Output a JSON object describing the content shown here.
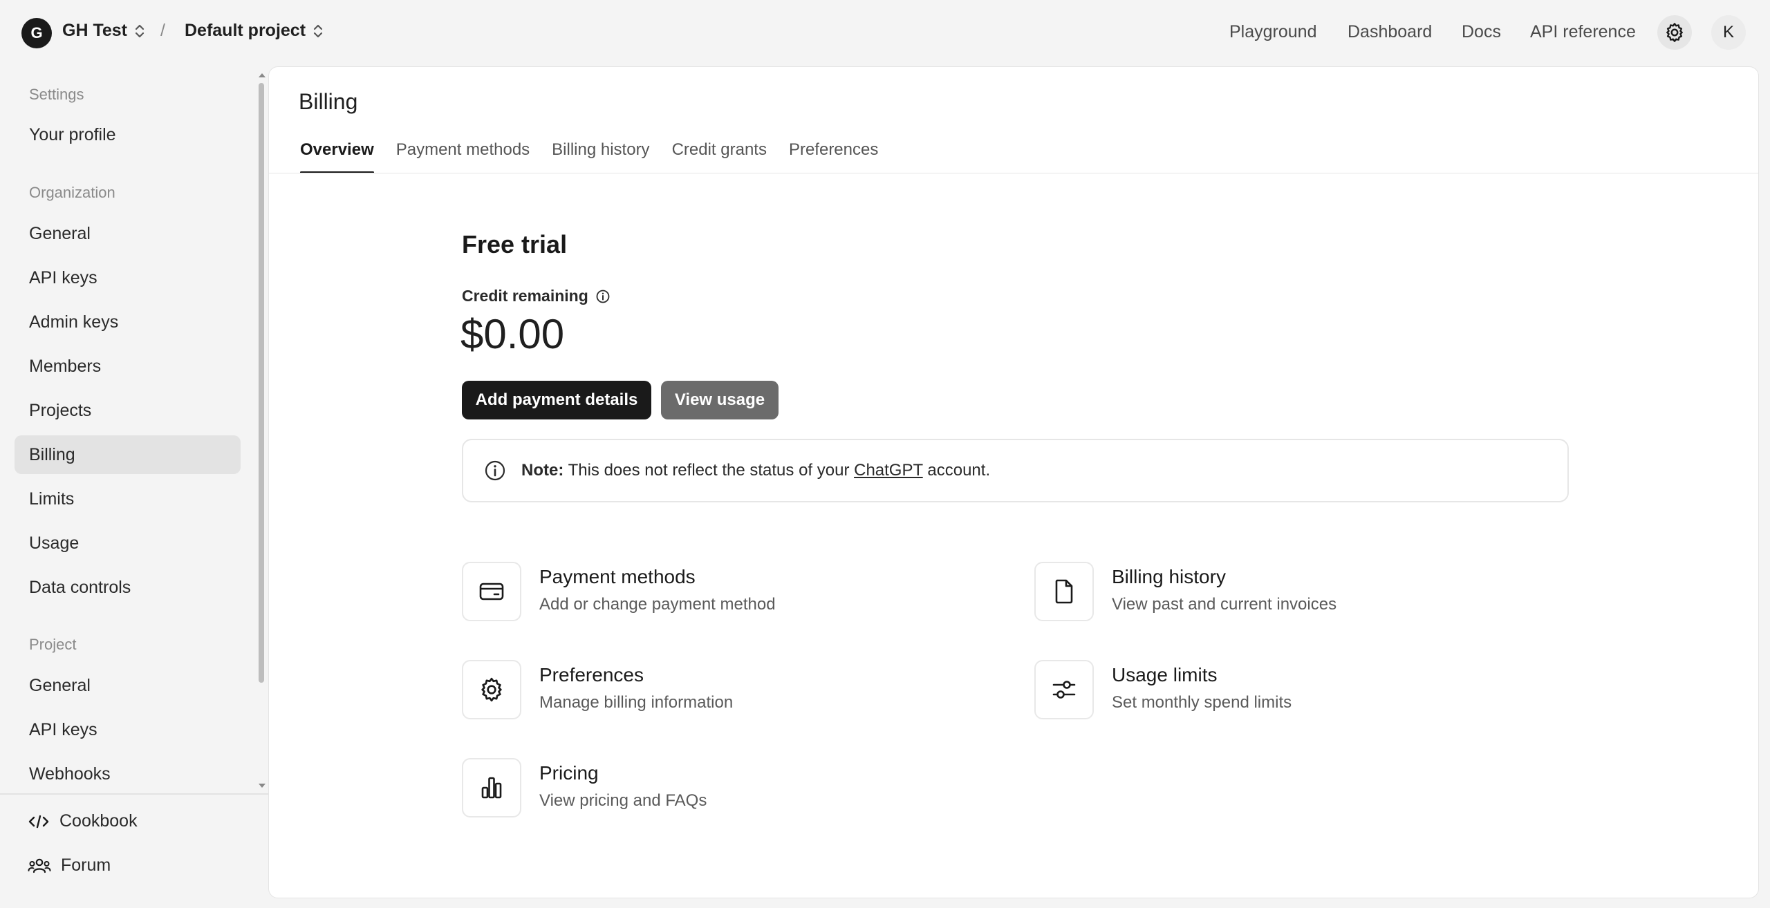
{
  "header": {
    "org_initial": "G",
    "org_name": "GH Test",
    "separator": "/",
    "project_name": "Default project",
    "nav": [
      "Playground",
      "Dashboard",
      "Docs",
      "API reference"
    ],
    "user_initial": "K"
  },
  "sidebar": {
    "settings_heading": "Settings",
    "profile": "Your profile",
    "organization_heading": "Organization",
    "org_items": [
      "General",
      "API keys",
      "Admin keys",
      "Members",
      "Projects",
      "Billing",
      "Limits",
      "Usage",
      "Data controls"
    ],
    "active_item": "Billing",
    "project_heading": "Project",
    "project_items": [
      "General",
      "API keys",
      "Webhooks"
    ],
    "footer": [
      "Cookbook",
      "Forum"
    ]
  },
  "main": {
    "title": "Billing",
    "tabs": [
      "Overview",
      "Payment methods",
      "Billing history",
      "Credit grants",
      "Preferences"
    ],
    "active_tab": "Overview",
    "plan_title": "Free trial",
    "credit_label": "Credit remaining",
    "credit_value": "$0.00",
    "add_payment_label": "Add payment details",
    "view_usage_label": "View usage",
    "note_label": "Note:",
    "note_text_before": "This does not reflect the status of your",
    "note_link": "ChatGPT",
    "note_text_after": "account.",
    "cards": [
      {
        "title": "Payment methods",
        "desc": "Add or change payment method"
      },
      {
        "title": "Billing history",
        "desc": "View past and current invoices"
      },
      {
        "title": "Preferences",
        "desc": "Manage billing information"
      },
      {
        "title": "Usage limits",
        "desc": "Set monthly spend limits"
      },
      {
        "title": "Pricing",
        "desc": "View pricing and FAQs"
      }
    ]
  },
  "icons": {
    "gear": "gear-icon",
    "info": "info-icon",
    "card": "credit-card-icon",
    "file": "file-icon",
    "sliders": "sliders-icon",
    "chart": "bar-chart-icon",
    "code": "code-icon",
    "people": "people-icon"
  }
}
